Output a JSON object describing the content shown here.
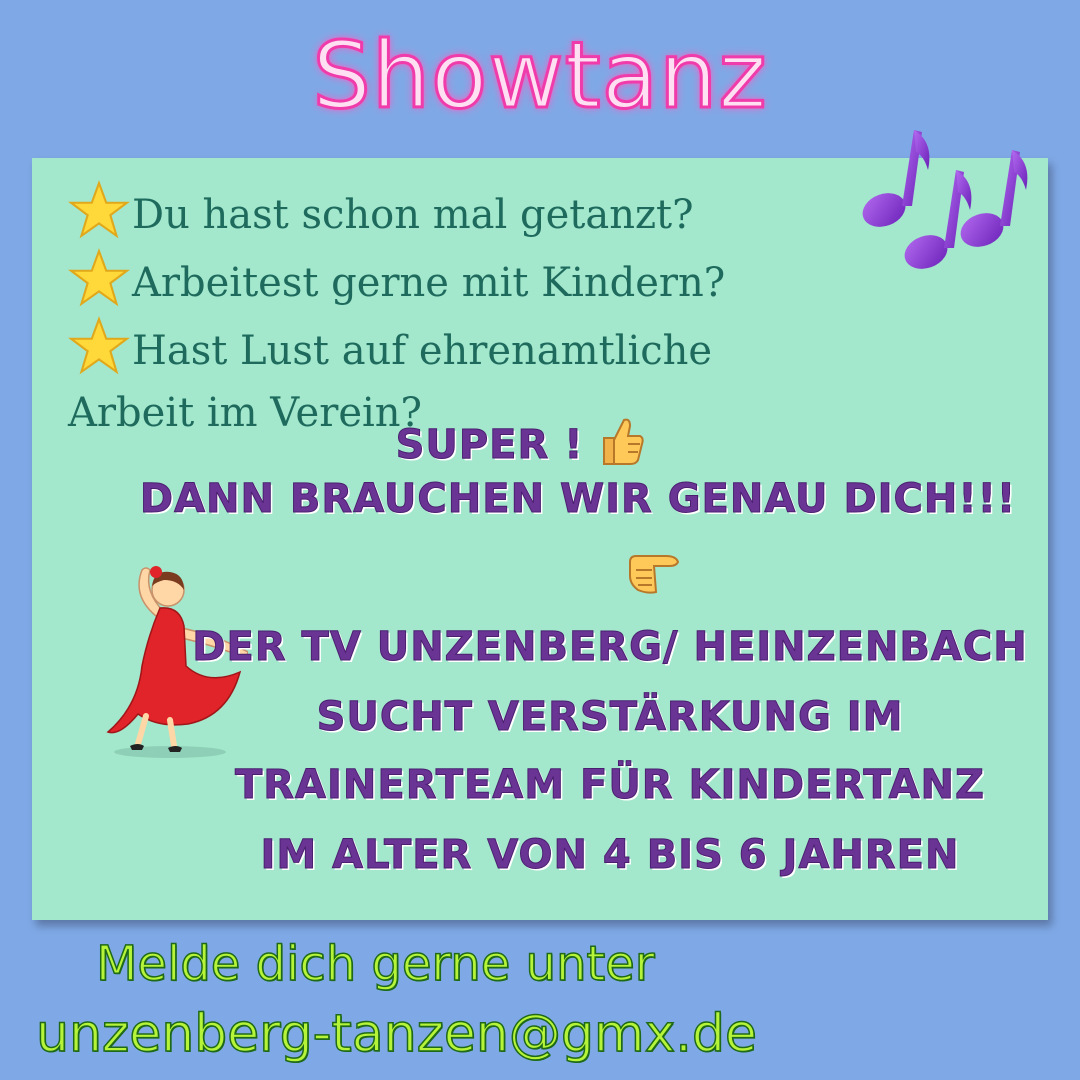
{
  "title": "Showtanz",
  "questions": [
    "Du hast schon mal getanzt?",
    "Arbeitest gerne mit Kindern?",
    "Hast Lust auf ehrenamtliche"
  ],
  "question_continuation": "Arbeit im Verein?",
  "super_text": "Super !",
  "need_you": "Dann brauchen wir genau Dich!!!",
  "announcement": [
    "Der TV Unzenberg/ Heinzenbach",
    "sucht Verstärkung im",
    "Trainerteam für Kindertanz",
    "im Alter von 4 bis 6 Jahren"
  ],
  "footer": {
    "line1": "Melde dich gerne unter",
    "email": "unzenberg-tanzen@gmx.de"
  },
  "icons": [
    "star-icon",
    "music-notes-icon",
    "thumbs-up-icon",
    "pointing-hand-icon",
    "dancer-icon"
  ],
  "colors": {
    "background": "#7fa9e6",
    "card": "#a3e7cc",
    "title_pink": "#f03caa",
    "question_green": "#1e6b5e",
    "purple_text": "#6a3494",
    "footer_green": "#b6f43a"
  }
}
